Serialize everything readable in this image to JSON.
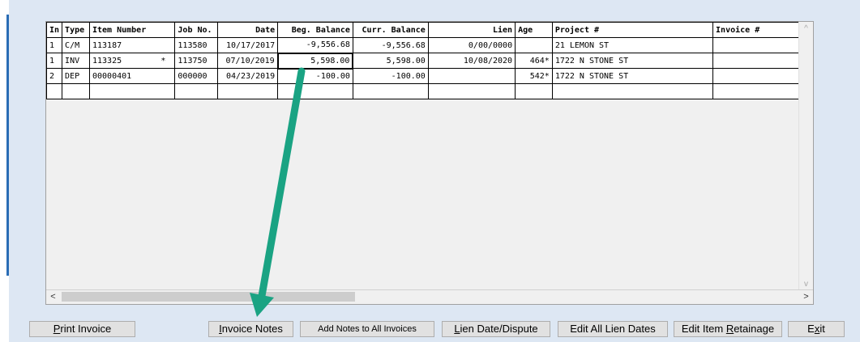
{
  "grid": {
    "columns": [
      {
        "label": "In",
        "align": "l"
      },
      {
        "label": "Type",
        "align": "l"
      },
      {
        "label": "Item Number",
        "align": "l"
      },
      {
        "label": "Job No.",
        "align": "l"
      },
      {
        "label": "Date",
        "align": "r"
      },
      {
        "label": "Beg. Balance",
        "align": "r"
      },
      {
        "label": "Curr. Balance",
        "align": "r"
      },
      {
        "label": "Lien",
        "align": "r"
      },
      {
        "label": "Age",
        "align": "l"
      },
      {
        "label": "Project #",
        "align": "l"
      },
      {
        "label": "Invoice #",
        "align": "l"
      }
    ],
    "rows": [
      {
        "in": "1",
        "type": "C/M",
        "item": "113187",
        "item_flag": "",
        "job": "113580",
        "date": "10/17/2017",
        "beg": "-9,556.68",
        "curr": "-9,556.68",
        "lien": "0/00/0000",
        "age": "",
        "project": "21 LEMON ST",
        "invoice": ""
      },
      {
        "in": "1",
        "type": "INV",
        "item": "113325",
        "item_flag": "*",
        "job": "113750",
        "date": "07/10/2019",
        "beg": "5,598.00",
        "curr": "5,598.00",
        "lien": "10/08/2020",
        "age": "464*",
        "project": "1722 N STONE ST",
        "invoice": ""
      },
      {
        "in": "2",
        "type": "DEP",
        "item": "00000401",
        "item_flag": "",
        "job": "000000",
        "date": "04/23/2019",
        "beg": "-100.00",
        "curr": "-100.00",
        "lien": "",
        "age": "542*",
        "project": "1722 N STONE ST",
        "invoice": ""
      },
      {
        "in": "",
        "type": "",
        "item": "",
        "item_flag": "",
        "job": "",
        "date": "",
        "beg": "",
        "curr": "",
        "lien": "",
        "age": "",
        "project": "",
        "invoice": ""
      }
    ],
    "selected_cell": {
      "row": 1,
      "column": "beg"
    }
  },
  "scrollbars": {
    "up_glyph": "^",
    "down_glyph": "v",
    "left_glyph": "<",
    "right_glyph": ">"
  },
  "buttons": {
    "print_invoice": {
      "pre": "",
      "ul": "P",
      "post": "rint Invoice"
    },
    "invoice_notes": {
      "pre": "",
      "ul": "I",
      "post": "nvoice Notes"
    },
    "add_notes_all": {
      "pre": "Add Notes to All Invoices",
      "ul": "",
      "post": ""
    },
    "lien_date_dispute": {
      "pre": "",
      "ul": "L",
      "post": "ien Date/Dispute"
    },
    "edit_all_lien_dates": {
      "pre": "Edit All Lien Dates",
      "ul": "",
      "post": ""
    },
    "edit_item_retainage": {
      "pre": "Edit Item ",
      "ul": "R",
      "post": "etainage"
    },
    "exit": {
      "pre": "E",
      "ul": "x",
      "post": "it"
    }
  },
  "colors": {
    "arrow": "#1aa383",
    "frame": "#dde7f3",
    "accent": "#2a6db5"
  },
  "annotation": {
    "type": "arrow",
    "from": "selected-beg-balance-cell",
    "to": "invoice-notes-button"
  }
}
